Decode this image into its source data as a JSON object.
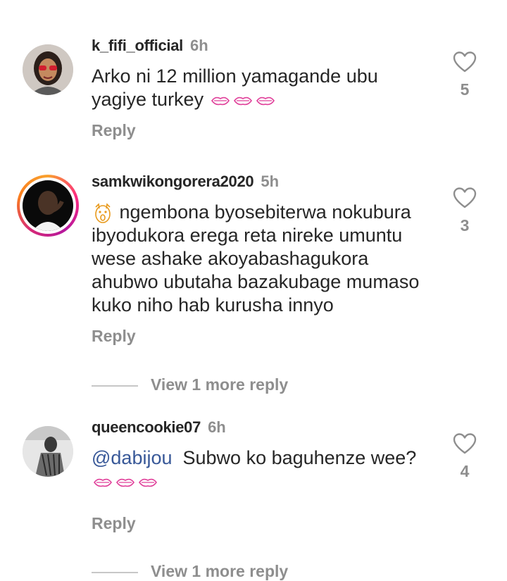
{
  "comments": [
    {
      "username": "k_fifi_official",
      "time": "6h",
      "text": "Arko ni 12 million yamagande ubu yagiye turkey",
      "emoji": [
        "kiss-lips-emoji",
        "kiss-lips-emoji",
        "kiss-lips-emoji"
      ],
      "reply_label": "Reply",
      "likes": "5"
    },
    {
      "username": "samkwikongorera2020",
      "time": "5h",
      "text": "ngembona byosebiterwa nokubura ibyodukora erega reta nireke umuntu wese ashake akoyabashagukora ahubwo ubutaha bazakubage mumaso kuko niho hab kurusha innyo",
      "leading_emoji": "screaming-face-emoji",
      "reply_label": "Reply",
      "likes": "3",
      "view_more": "View 1 more reply"
    },
    {
      "username": "queencookie07",
      "time": "6h",
      "mention": "@dabijou",
      "text": "Subwo ko baguhenze wee?",
      "emoji": [
        "kiss-lips-emoji",
        "kiss-lips-emoji",
        "kiss-lips-emoji"
      ],
      "reply_label": "Reply",
      "likes": "4",
      "view_more": "View 1 more reply"
    }
  ],
  "colors": {
    "accent": "#385898",
    "muted": "#8e8e8e",
    "text": "#262626",
    "emoji": "#e0409a"
  }
}
